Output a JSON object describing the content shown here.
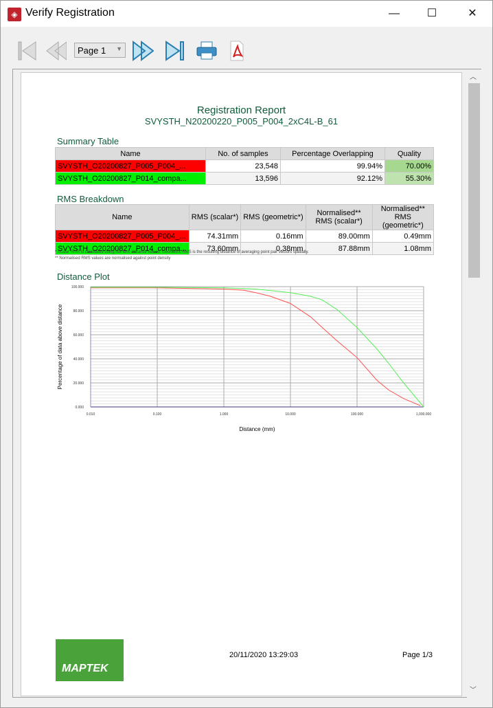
{
  "window": {
    "title": "Verify Registration",
    "minimize": "—",
    "maximize": "☐",
    "close": "✕"
  },
  "toolbar": {
    "page_select": "Page 1"
  },
  "report": {
    "title": "Registration Report",
    "subtitle": "SVYSTH_N20200220_P005_P004_2xC4L-B_61",
    "summary": {
      "heading": "Summary Table",
      "columns": [
        "Name",
        "No. of samples",
        "Percentage Overlapping",
        "Quality"
      ],
      "rows": [
        [
          "SVYSTH_O20200827_P005_P004_...",
          "23,548",
          "99.94%",
          "70.00%"
        ],
        [
          "SVYSTH_O20200827_P014_compa...",
          "13,596",
          "92.12%",
          "55.30%"
        ]
      ]
    },
    "rms": {
      "heading": "RMS Breakdown",
      "columns": [
        "Name",
        "RMS (scalar*)",
        "RMS (geometric*)",
        "Normalised** RMS (scalar*)",
        "Normalised** RMS (geometric*)"
      ],
      "rows": [
        [
          "SVYSTH_O20200827_P005_P004_...",
          "74.31mm",
          "0.16mm",
          "89.00mm",
          "0.49mm"
        ],
        [
          "SVYSTH_O20200827_P014_compa...",
          "73.60mm",
          "0.38mm",
          "87.88mm",
          "1.08mm"
        ]
      ],
      "note1": "* Scalar RMS is calculated using numeric distance values. Geometric RMS is the resulting distance of averaging point pair vectors spatially.",
      "note2": "** Normalised RMS values are normalised against point density"
    },
    "plot_heading": "Distance Plot",
    "footer": {
      "logo": "MAPTEK",
      "date": "20/11/2020 13:29:03",
      "page": "Page 1/3"
    }
  },
  "chart_data": {
    "type": "line",
    "xscale": "log",
    "xlabel": "Distance (mm)",
    "ylabel": "Percentage of data above distance",
    "xlim": [
      0.01,
      1000
    ],
    "ylim": [
      0,
      100
    ],
    "grid": true,
    "xticks": [
      "0.010",
      "0.100",
      "1.000",
      "10.000",
      "100.000",
      "1,000.000"
    ],
    "yticks": [
      "0.000",
      "20.000",
      "40.000",
      "60.000",
      "80.000",
      "100.000"
    ],
    "series": [
      {
        "name": "SVYSTH_O20200827_P005_P004",
        "color": "#ff5050",
        "x": [
          0.01,
          0.1,
          1,
          2,
          3,
          5,
          10,
          20,
          30,
          50,
          100,
          200,
          300,
          500,
          900
        ],
        "y": [
          99,
          99,
          98,
          97,
          95,
          92,
          86,
          75,
          66,
          55,
          41,
          22,
          14,
          7,
          1
        ]
      },
      {
        "name": "SVYSTH_O20200827_P014",
        "color": "#55ee55",
        "x": [
          0.01,
          0.1,
          1,
          3,
          10,
          20,
          30,
          50,
          100,
          200,
          300,
          500,
          1000
        ],
        "y": [
          99.5,
          99.5,
          99,
          98,
          95,
          92,
          89,
          81,
          66,
          48,
          36,
          20,
          0
        ]
      }
    ]
  }
}
